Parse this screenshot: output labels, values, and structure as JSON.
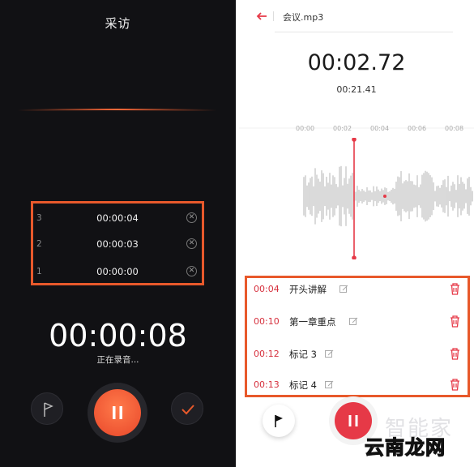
{
  "left": {
    "title": "采访",
    "marks": [
      {
        "index": "3",
        "time": "00:00:04"
      },
      {
        "index": "2",
        "time": "00:00:03"
      },
      {
        "index": "1",
        "time": "00:00:00"
      }
    ],
    "elapsed": "00:00:08",
    "status": "正在录音..."
  },
  "right": {
    "file_name": "会议.mp3",
    "current_time": "00:02.72",
    "total_time": "00:21.41",
    "ruler_ticks": [
      "00:00",
      "00:02",
      "00:04",
      "00:06",
      "00:08"
    ],
    "marks": [
      {
        "time": "00:04",
        "name": "开头讲解"
      },
      {
        "time": "00:10",
        "name": "第一章重点"
      },
      {
        "time": "00:12",
        "name": "标记 3"
      },
      {
        "time": "00:13",
        "name": "标记 4"
      }
    ]
  },
  "watermark": {
    "text_top": "智能家",
    "text_bottom": "云南龙网"
  },
  "colors": {
    "accent_orange": "#e8592b",
    "accent_red": "#e63947",
    "mark_time_red": "#d6303d"
  }
}
